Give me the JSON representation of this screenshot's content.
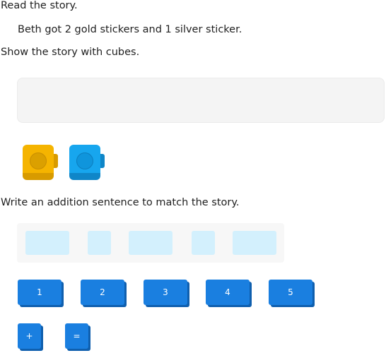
{
  "instructions": {
    "read": "Read the story.",
    "story": "Beth got 2 gold stickers and 1 silver sticker.",
    "show": "Show the story with cubes.",
    "write": "Write an addition sentence to match the story."
  },
  "cubes": [
    {
      "color_name": "gold",
      "color": "#f5b400"
    },
    {
      "color_name": "silver",
      "color": "#17a6ee"
    }
  ],
  "tiles": {
    "numbers": [
      "1",
      "2",
      "3",
      "4",
      "5"
    ],
    "operators": [
      "+",
      "="
    ]
  },
  "colors": {
    "tile": "#1a7fe0",
    "slot": "#d3f0fd",
    "dropzone": "#f4f4f4"
  }
}
